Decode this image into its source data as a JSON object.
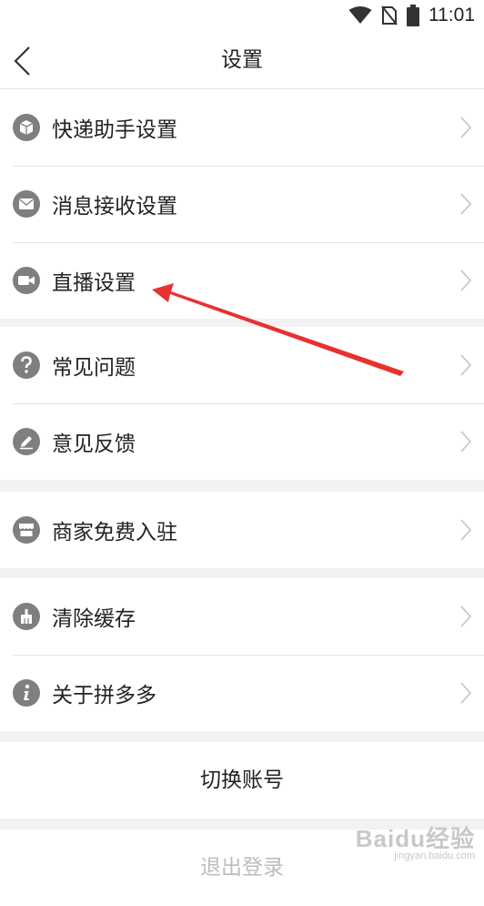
{
  "status_bar": {
    "time": "11:01"
  },
  "nav": {
    "title": "设置"
  },
  "groups": [
    {
      "items": [
        {
          "label": "快递助手设置",
          "icon": "package-icon"
        },
        {
          "label": "消息接收设置",
          "icon": "mail-icon"
        },
        {
          "label": "直播设置",
          "icon": "video-camera-icon"
        }
      ]
    },
    {
      "items": [
        {
          "label": "常见问题",
          "icon": "question-icon"
        },
        {
          "label": "意见反馈",
          "icon": "pencil-icon"
        }
      ]
    },
    {
      "items": [
        {
          "label": "商家免费入驻",
          "icon": "store-icon"
        }
      ]
    },
    {
      "items": [
        {
          "label": "清除缓存",
          "icon": "broom-icon"
        },
        {
          "label": "关于拼多多",
          "icon": "info-icon"
        }
      ]
    }
  ],
  "buttons": {
    "switch_account": "切换账号",
    "logout": "退出登录"
  },
  "colors": {
    "annotation_arrow": "#e8312f",
    "icon_gray": "#7f7f7f"
  },
  "watermark": {
    "brand": "Baidu经验",
    "url": "jingyan.baidu.com"
  }
}
